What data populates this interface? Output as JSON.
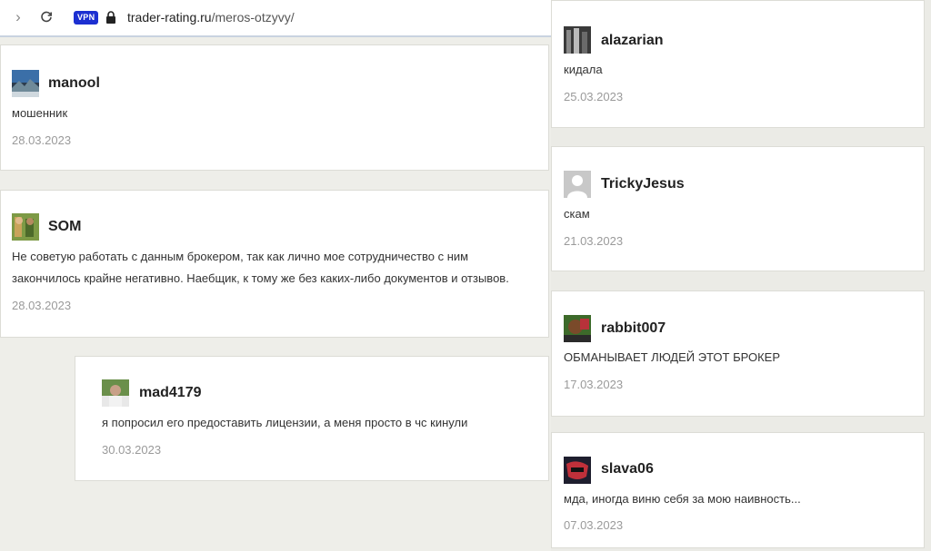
{
  "browser": {
    "url_domain": "trader-rating.ru",
    "url_path": "/meros-otzyvy/",
    "vpn_label": "VPN"
  },
  "left_reviews": [
    {
      "username": "manool",
      "text": "мошенник",
      "date": "28.03.2023"
    },
    {
      "username": "SOM",
      "text_line1": "Не советую работать с данным брокером, так как лично мое сотрудничество с ним",
      "text_line2": "закончилось крайне  негативно. Наебщик, к тому же без каких-либо документов и отзывов.",
      "date": "28.03.2023"
    },
    {
      "username": "mad4179",
      "text": "я попросил его предоставить лицензии, а меня просто в чс кинули",
      "date": "30.03.2023"
    }
  ],
  "right_reviews": [
    {
      "username": "alazarian",
      "text": "кидала",
      "date": "25.03.2023"
    },
    {
      "username": "TrickyJesus",
      "text": "скам",
      "date": "21.03.2023"
    },
    {
      "username": "rabbit007",
      "text": "ОБМАНЫВАЕТ ЛЮДЕЙ ЭТОТ БРОКЕР",
      "date": "17.03.2023"
    },
    {
      "username": "slava06",
      "text": "мда, иногда виню себя за мою наивность...",
      "date": "07.03.2023"
    }
  ]
}
